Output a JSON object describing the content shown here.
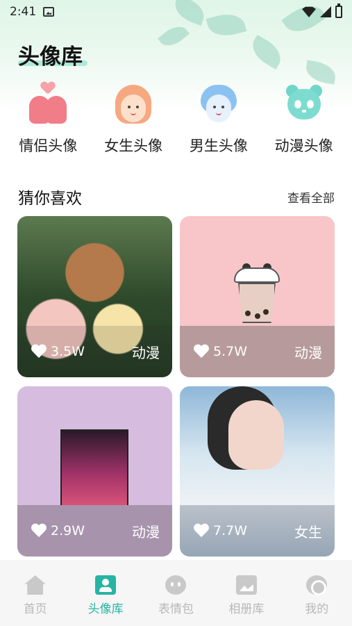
{
  "status": {
    "time": "2:41"
  },
  "header": {
    "title": "头像库"
  },
  "categories": [
    {
      "label": "情侣头像",
      "icon": "couple-icon",
      "color": "#f07d88"
    },
    {
      "label": "女生头像",
      "icon": "girl-icon",
      "color": "#f6a880"
    },
    {
      "label": "男生头像",
      "icon": "boy-icon",
      "color": "#8cc2f2"
    },
    {
      "label": "动漫头像",
      "icon": "panda-icon",
      "color": "#7ddccf"
    }
  ],
  "section": {
    "title": "猜你喜欢",
    "more": "查看全部"
  },
  "cards": [
    {
      "likes": "3.5W",
      "tag": "动漫",
      "art": "garden-palace-image"
    },
    {
      "likes": "5.7W",
      "tag": "动漫",
      "art": "panda-bubble-tea-image"
    },
    {
      "likes": "2.9W",
      "tag": "动漫",
      "art": "mecha-poster-image"
    },
    {
      "likes": "7.7W",
      "tag": "女生",
      "art": "girl-portrait-image"
    }
  ],
  "tabs": [
    {
      "label": "首页",
      "icon": "home-icon",
      "active": false
    },
    {
      "label": "头像库",
      "icon": "avatar-icon",
      "active": true
    },
    {
      "label": "表情包",
      "icon": "emoji-icon",
      "active": false
    },
    {
      "label": "相册库",
      "icon": "album-icon",
      "active": false
    },
    {
      "label": "我的",
      "icon": "profile-icon",
      "active": false
    }
  ],
  "colors": {
    "accent": "#27b4a4",
    "tab_inactive": "#b8b8b8"
  }
}
